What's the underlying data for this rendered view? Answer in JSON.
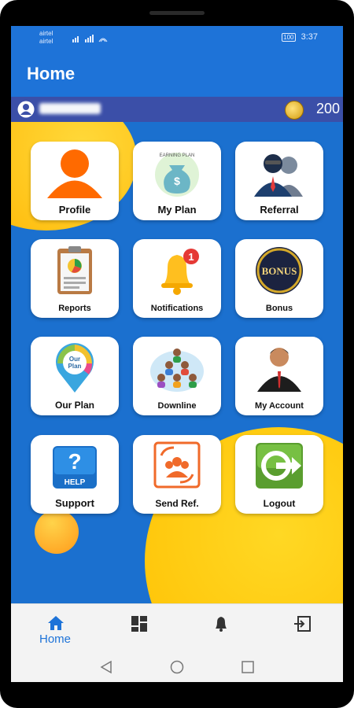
{
  "status": {
    "carrier1": "airtel",
    "carrier2": "airtel",
    "battery": "100",
    "time": "3:37"
  },
  "appbar": {
    "title": "Home"
  },
  "user": {
    "coins": "200"
  },
  "tiles": [
    {
      "label": "Profile"
    },
    {
      "label": "My Plan",
      "badge_text": "EARNING PLAN"
    },
    {
      "label": "Referral"
    },
    {
      "label": "Reports"
    },
    {
      "label": "Notifications",
      "badge": "1"
    },
    {
      "label": "Bonus",
      "badge_text": "BONUS"
    },
    {
      "label": "Our Plan",
      "badge_text": "Our Plan"
    },
    {
      "label": "Downline"
    },
    {
      "label": "My Account"
    },
    {
      "label": "Support",
      "badge_text": "HELP"
    },
    {
      "label": "Send Ref."
    },
    {
      "label": "Logout"
    }
  ],
  "bottom_nav": {
    "home_label": "Home",
    "active": "home"
  },
  "colors": {
    "primary": "#1e73d8",
    "userbar": "#3b4fa8",
    "accent": "#ffc400"
  }
}
